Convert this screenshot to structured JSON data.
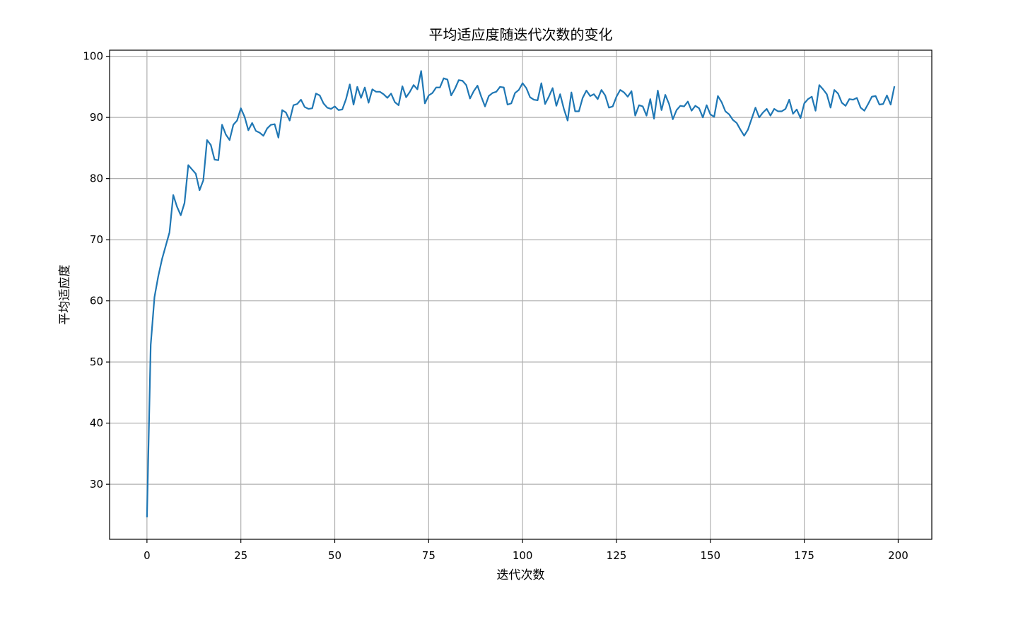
{
  "chart_data": {
    "type": "line",
    "title": "平均适应度随迭代次数的变化",
    "xlabel": "迭代次数",
    "ylabel": "平均适应度",
    "xlim": [
      -9.95,
      208.95
    ],
    "ylim": [
      21.0,
      101.0
    ],
    "xticks": [
      0,
      25,
      50,
      75,
      100,
      125,
      150,
      175,
      200
    ],
    "yticks": [
      30,
      40,
      50,
      60,
      70,
      80,
      90,
      100
    ],
    "grid": true,
    "color": "#1f77b4",
    "series": [
      {
        "x_start": 0,
        "x_step": 1,
        "values": [
          24.6,
          52.8,
          60.6,
          64.0,
          66.8,
          69.0,
          71.2,
          77.3,
          75.4,
          74.0,
          76.0,
          82.2,
          81.5,
          80.8,
          78.1,
          79.7,
          86.3,
          85.5,
          83.1,
          83.0,
          88.8,
          87.2,
          86.3,
          88.8,
          89.5,
          91.5,
          90.1,
          87.9,
          89.1,
          87.8,
          87.5,
          87.0,
          88.2,
          88.8,
          88.9,
          86.7,
          91.2,
          90.8,
          89.5,
          92.0,
          92.2,
          92.9,
          91.7,
          91.4,
          91.5,
          93.9,
          93.6,
          92.3,
          91.6,
          91.4,
          91.8,
          91.2,
          91.3,
          93.0,
          95.4,
          92.1,
          95.0,
          93.2,
          94.9,
          92.4,
          94.6,
          94.2,
          94.2,
          93.8,
          93.2,
          93.9,
          92.5,
          92.0,
          95.1,
          93.3,
          94.2,
          95.3,
          94.6,
          97.6,
          92.3,
          93.6,
          94.0,
          94.9,
          94.9,
          96.4,
          96.2,
          93.6,
          94.7,
          96.1,
          96.0,
          95.3,
          93.1,
          94.3,
          95.2,
          93.4,
          91.8,
          93.5,
          94.0,
          94.2,
          95.0,
          94.9,
          92.1,
          92.3,
          94.0,
          94.5,
          95.6,
          94.8,
          93.3,
          92.9,
          92.8,
          95.6,
          92.2,
          93.4,
          94.8,
          91.9,
          93.8,
          91.4,
          89.5,
          94.1,
          91.0,
          91.0,
          93.2,
          94.4,
          93.5,
          93.8,
          93.0,
          94.5,
          93.6,
          91.6,
          91.8,
          93.4,
          94.5,
          94.1,
          93.4,
          94.3,
          90.3,
          92.0,
          91.8,
          90.3,
          93.0,
          89.8,
          94.4,
          91.2,
          93.7,
          92.2,
          89.7,
          91.2,
          91.9,
          91.8,
          92.6,
          91.1,
          91.9,
          91.5,
          90.0,
          92.0,
          90.5,
          90.1,
          93.5,
          92.5,
          91.0,
          90.5,
          89.6,
          89.1,
          88.0,
          87.0,
          88.0,
          89.8,
          91.6,
          90.0,
          90.8,
          91.4,
          90.3,
          91.4,
          91.0,
          91.0,
          91.4,
          92.9,
          90.6,
          91.3,
          89.9,
          92.3,
          93.0,
          93.4,
          91.1,
          95.3,
          94.6,
          93.8,
          91.6,
          94.5,
          93.9,
          92.4,
          91.9,
          93.0,
          92.9,
          93.2,
          91.6,
          91.1,
          92.2,
          93.4,
          93.5,
          92.1,
          92.2,
          93.6,
          92.1,
          95.1
        ]
      }
    ]
  }
}
